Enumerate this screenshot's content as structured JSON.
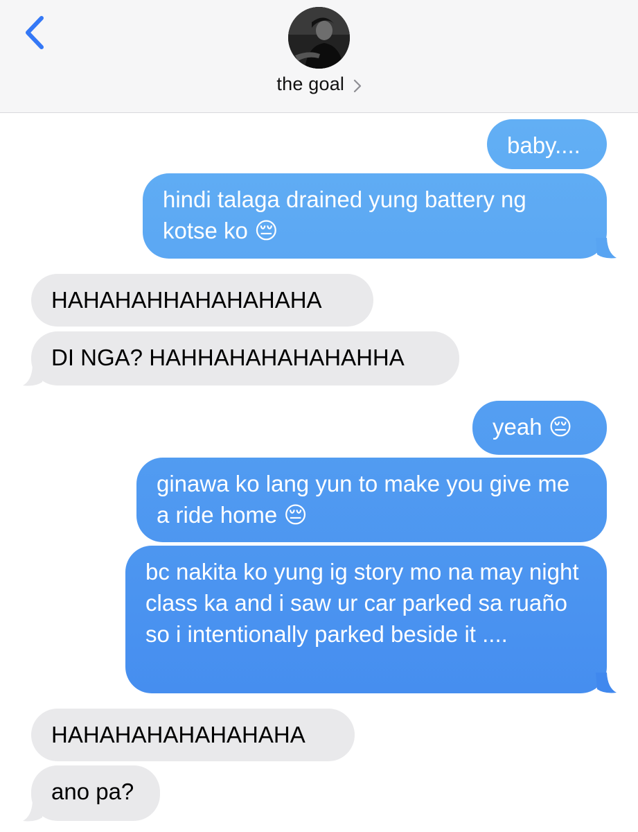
{
  "header": {
    "contact_name": "the goal",
    "back_icon": "chevron-left-icon",
    "detail_icon": "chevron-right-icon"
  },
  "colors": {
    "sent_top": "#68b6f5",
    "sent_bottom": "#3f86ee",
    "received": "#e9e9eb",
    "back_blue": "#3478f6"
  },
  "messages": [
    {
      "direction": "sent",
      "text": "baby...."
    },
    {
      "direction": "sent",
      "text": "hindi talaga drained yung battery ng kotse ko 😔"
    },
    {
      "direction": "received",
      "text": "HAHAHAHHAHAHAHAHA"
    },
    {
      "direction": "received",
      "text": "DI NGA? HAHHAHAHAHAHAHHA"
    },
    {
      "direction": "sent",
      "text": "yeah 😔"
    },
    {
      "direction": "sent",
      "text": "ginawa ko lang yun to make you give me a ride home 😔"
    },
    {
      "direction": "sent",
      "text": "bc nakita ko yung ig story mo na may night class ka and i saw ur car parked sa ruaño so i intentionally parked beside it ...."
    },
    {
      "direction": "received",
      "text": "HAHAHAHAHAHAHAHA"
    },
    {
      "direction": "received",
      "text": "ano pa?"
    }
  ]
}
